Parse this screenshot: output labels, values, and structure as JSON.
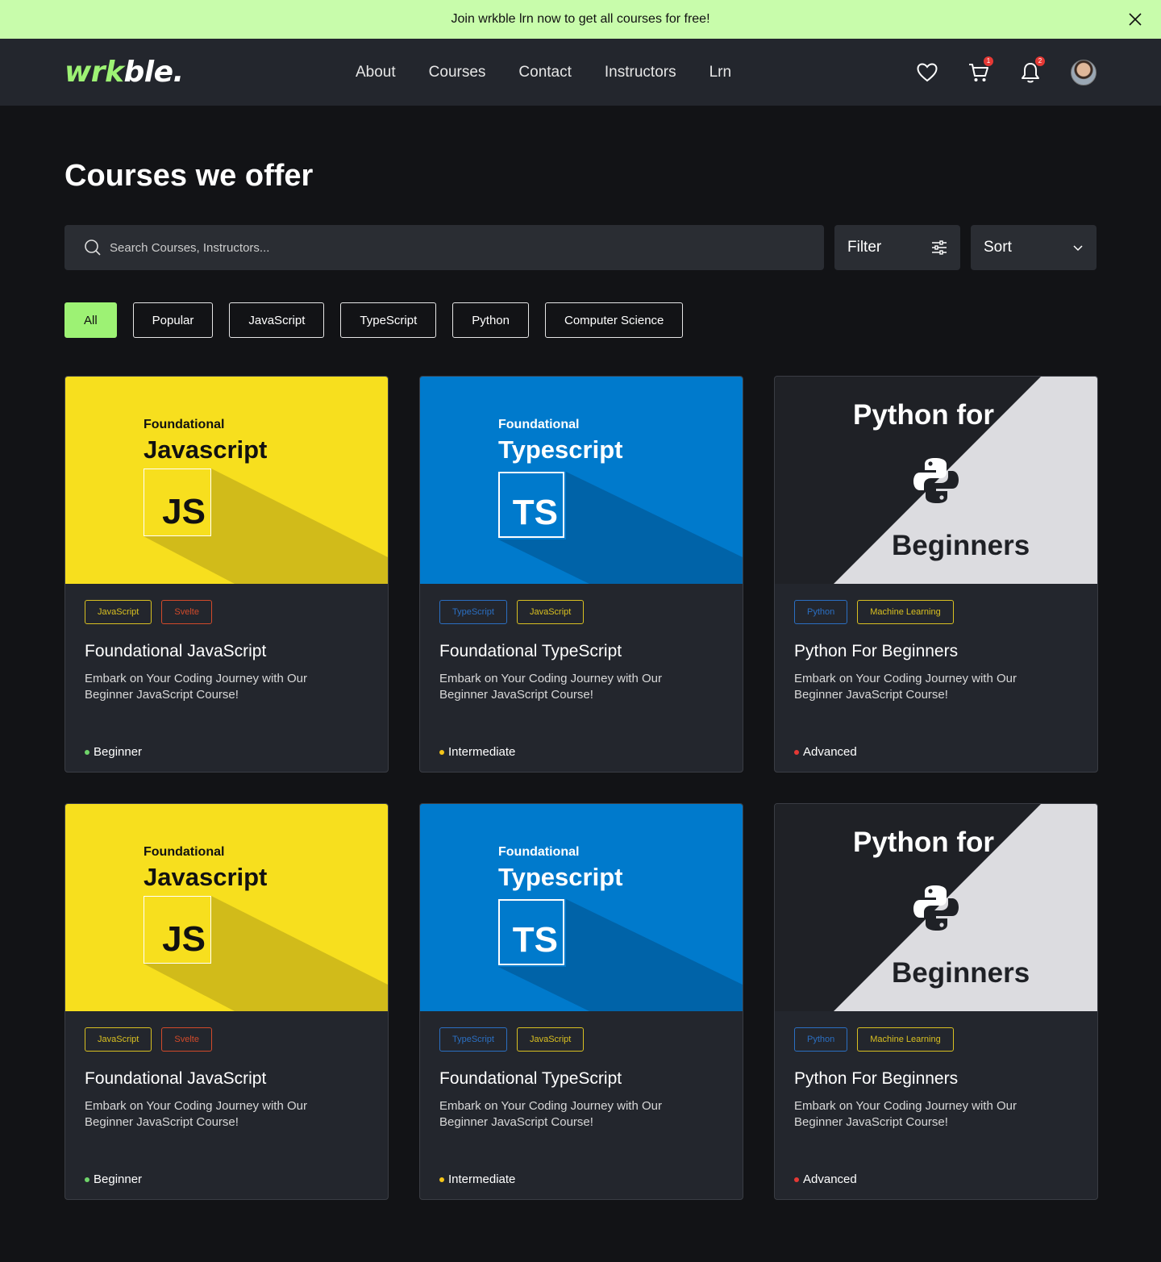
{
  "banner": {
    "text": "Join wrkble lrn now to get all courses for free!"
  },
  "header": {
    "logo_part1": "wrk",
    "logo_part2": "ble.",
    "nav": [
      "About",
      "Courses",
      "Contact",
      "Instructors",
      "Lrn"
    ],
    "cart_badge": "1",
    "notifications_badge": "2"
  },
  "page": {
    "title": "Courses we offer"
  },
  "search": {
    "placeholder": "Search Courses, Instructors..."
  },
  "filter": {
    "label": "Filter"
  },
  "sort": {
    "label": "Sort"
  },
  "chips": [
    "All",
    "Popular",
    "JavaScript",
    "TypeScript",
    "Python",
    "Computer  Science"
  ],
  "colors": {
    "accent": "#9df274",
    "banner_bg": "#c8fcab",
    "js_yellow": "#f7df1e",
    "ts_blue": "#007acc",
    "beginner": "#6fd46a",
    "intermediate": "#f5c518",
    "advanced": "#e53935"
  },
  "cards": [
    {
      "kind": "js",
      "thumb_sub": "Foundational",
      "thumb_main": "Javascript",
      "logo": "JS",
      "tags": [
        {
          "label": "JavaScript",
          "color": "#d9c021"
        },
        {
          "label": "Svelte",
          "color": "#d24a2a"
        }
      ],
      "title": "Foundational JavaScript",
      "desc": "Embark on Your Coding Journey with Our Beginner JavaScript Course!",
      "level": "Beginner",
      "level_color": "#6fd46a"
    },
    {
      "kind": "ts",
      "thumb_sub": "Foundational",
      "thumb_main": "Typescript",
      "logo": "TS",
      "tags": [
        {
          "label": "TypeScript",
          "color": "#2b6fc2"
        },
        {
          "label": "JavaScript",
          "color": "#d9c021"
        }
      ],
      "title": "Foundational TypeScript",
      "desc": "Embark on Your Coding Journey with Our Beginner JavaScript Course!",
      "level": "Intermediate",
      "level_color": "#f5c518"
    },
    {
      "kind": "py",
      "thumb_top": "Python for",
      "thumb_bottom": "Beginners",
      "tags": [
        {
          "label": "Python",
          "color": "#2b6fc2"
        },
        {
          "label": "Machine Learning",
          "color": "#d9c021"
        }
      ],
      "title": "Python For Beginners",
      "desc": "Embark on Your Coding Journey with Our Beginner JavaScript Course!",
      "level": "Advanced",
      "level_color": "#e53935"
    },
    {
      "kind": "js",
      "thumb_sub": "Foundational",
      "thumb_main": "Javascript",
      "logo": "JS",
      "tags": [
        {
          "label": "JavaScript",
          "color": "#d9c021"
        },
        {
          "label": "Svelte",
          "color": "#d24a2a"
        }
      ],
      "title": "Foundational JavaScript",
      "desc": "Embark on Your Coding Journey with Our Beginner JavaScript Course!",
      "level": "Beginner",
      "level_color": "#6fd46a"
    },
    {
      "kind": "ts",
      "thumb_sub": "Foundational",
      "thumb_main": "Typescript",
      "logo": "TS",
      "tags": [
        {
          "label": "TypeScript",
          "color": "#2b6fc2"
        },
        {
          "label": "JavaScript",
          "color": "#d9c021"
        }
      ],
      "title": "Foundational TypeScript",
      "desc": "Embark on Your Coding Journey with Our Beginner JavaScript Course!",
      "level": "Intermediate",
      "level_color": "#f5c518"
    },
    {
      "kind": "py",
      "thumb_top": "Python for",
      "thumb_bottom": "Beginners",
      "tags": [
        {
          "label": "Python",
          "color": "#2b6fc2"
        },
        {
          "label": "Machine Learning",
          "color": "#d9c021"
        }
      ],
      "title": "Python For Beginners",
      "desc": "Embark on Your Coding Journey with Our Beginner JavaScript Course!",
      "level": "Advanced",
      "level_color": "#e53935"
    }
  ]
}
